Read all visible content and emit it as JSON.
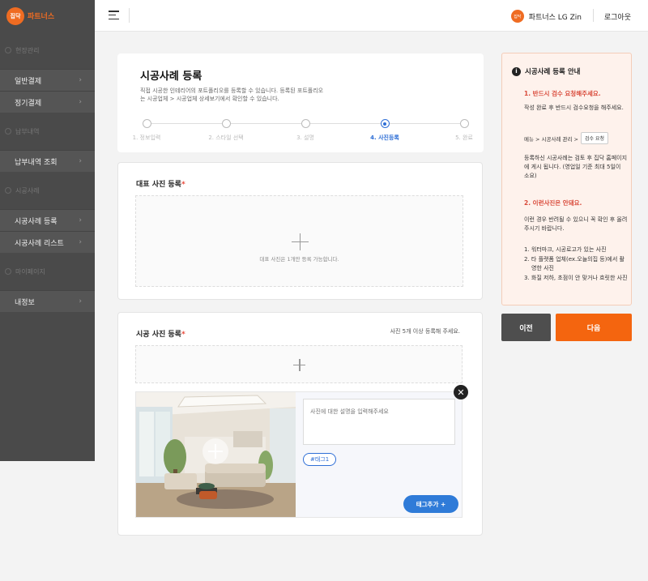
{
  "brand": {
    "badge": "집닥",
    "name": "파트너스"
  },
  "colors": {
    "accent": "#ef6c22",
    "primary_blue": "#2f6fd6",
    "sidebar": "#4a4a4a",
    "required": "#e84b3c"
  },
  "sidebar": {
    "sections": [
      {
        "title": "현장관리",
        "items": [
          {
            "label": "일반결제"
          },
          {
            "label": "정기결제"
          }
        ]
      },
      {
        "title": "납부내역",
        "items": [
          {
            "label": "납부내역 조회"
          }
        ]
      },
      {
        "title": "시공사례",
        "items": [
          {
            "label": "시공사례 등록"
          },
          {
            "label": "시공사례 리스트"
          }
        ]
      },
      {
        "title": "마이페이지",
        "items": [
          {
            "label": "내정보"
          }
        ]
      }
    ],
    "chevron": "›"
  },
  "header": {
    "partner_logo_text": "집닥",
    "partner_name": "파트너스 LG Zin",
    "logout": "로그아웃"
  },
  "page": {
    "title": "시공사례 등록",
    "desc": "직접 시공한 인테리어의 포트폴리오를 등록할 수 있습니다. 등록된 포트폴리오는 시공업체 > 시공업체 상세보기에서 확인할 수 있습니다.",
    "steps": [
      {
        "label": "1. 정보입력"
      },
      {
        "label": "2. 스타일 선택"
      },
      {
        "label": "3. 설명"
      },
      {
        "label": "4. 사진등록"
      },
      {
        "label": "5. 완료"
      }
    ]
  },
  "main_photo": {
    "title": "대표 사진 등록",
    "required_mark": "*",
    "hint": "대표 사진은 1개만 등록 가능합니다."
  },
  "photos": {
    "title": "시공 사진 등록",
    "required_mark": "*",
    "note": "사진 5개 이상 등록해 주세요.",
    "item": {
      "desc_placeholder": "사진에 대한 설명을 입력해주세요",
      "tag": "#태그1",
      "tag_add": "태그추가 +",
      "close": "✕"
    }
  },
  "info": {
    "title": "시공사례 등록 안내",
    "icon": "i",
    "rule1_title": "1. 반드시 검수 요청해주세요.",
    "rule1_text": "작성 완료 후 반드시 검수요청을 해주세요.",
    "path_text": "메뉴 > 시공사례 관리 >",
    "path_button": "검수 요청",
    "rule1_note": "등록하신 시공사례는 검토 후 집닥 홈페이지에 게시 됩니다. (영업일 기준 최대 5일이 소요)",
    "rule2_title": "2. 이런사진은 안돼요.",
    "rule2_text": "이런 경우 반려될 수 있으니 꼭 확인 후 올려주시기 바랍니다.",
    "rule2_list": [
      "1. 워터마크, 시공로고가 있는 사진",
      "2. 타 플랫폼 업체(ex.오늘의집 등)에서 촬영한 사진",
      "3. 화질 저하, 초점이 안 맞거나 흐릿한 사진"
    ]
  },
  "buttons": {
    "prev": "이전",
    "next": "다음"
  }
}
